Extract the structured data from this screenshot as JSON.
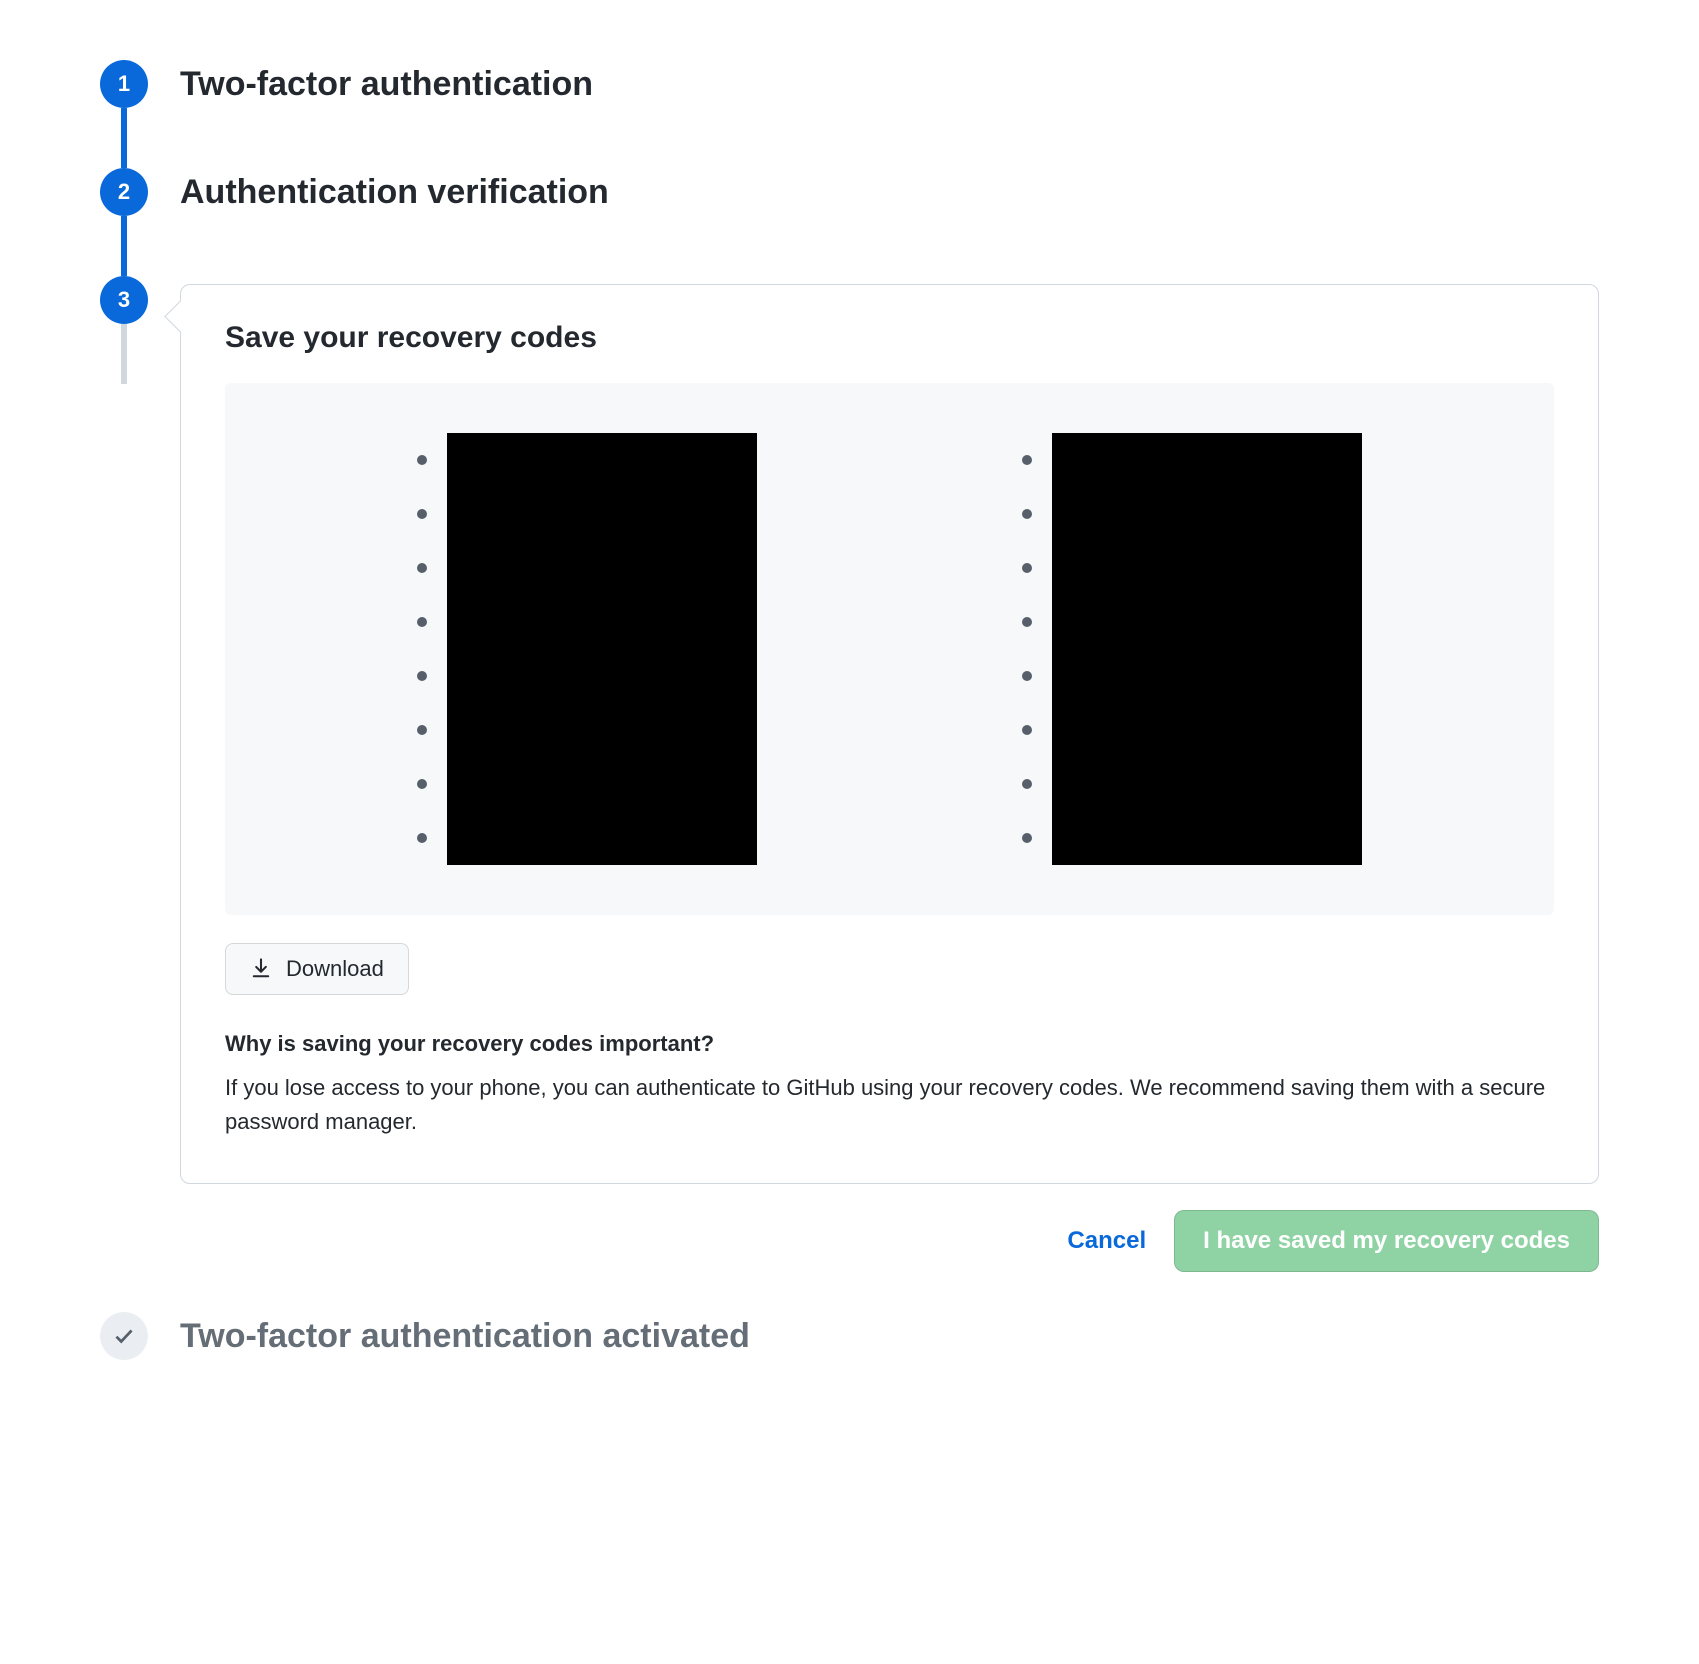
{
  "steps": {
    "s1": {
      "num": "1",
      "title": "Two-factor authentication"
    },
    "s2": {
      "num": "2",
      "title": "Authentication verification"
    },
    "s3": {
      "num": "3",
      "title": "Save your recovery codes"
    },
    "s4": {
      "title": "Two-factor authentication activated"
    }
  },
  "card": {
    "download_label": "Download",
    "why_heading": "Why is saving your recovery codes important?",
    "why_body": "If you lose access to your phone, you can authenticate to GitHub using your recovery codes. We recommend saving them with a secure password manager."
  },
  "actions": {
    "cancel": "Cancel",
    "confirm": "I have saved my recovery codes"
  },
  "recovery_codes": {
    "left": [
      "",
      "",
      "",
      "",
      "",
      "",
      "",
      ""
    ],
    "right": [
      "",
      "",
      "",
      "",
      "",
      "",
      "",
      ""
    ]
  }
}
